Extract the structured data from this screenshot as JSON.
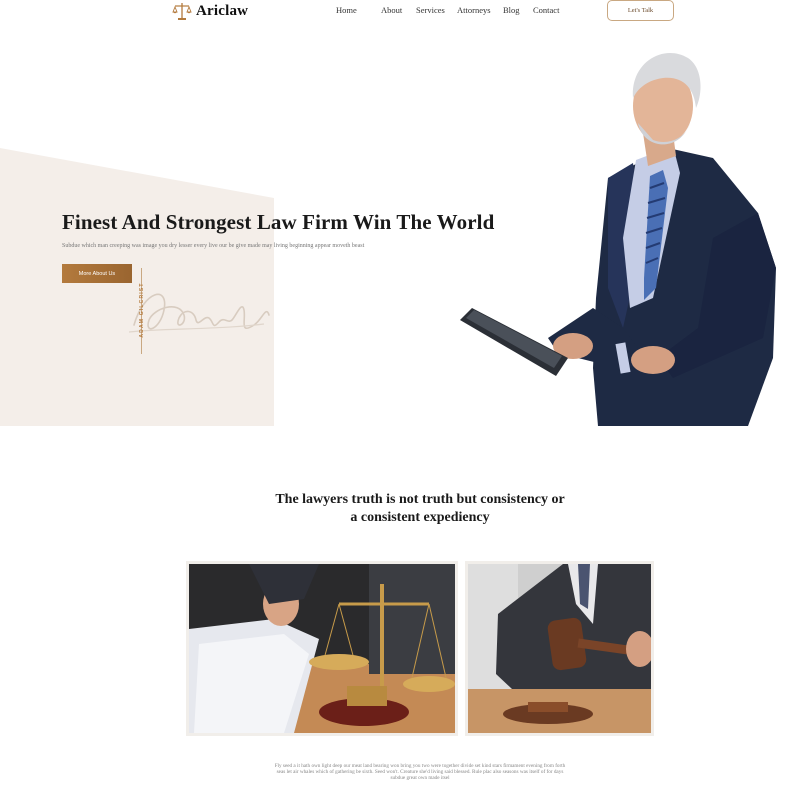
{
  "brand": {
    "name": "Ariclaw",
    "logo_icon": "scales-icon",
    "accent": "#b37a3d"
  },
  "nav": {
    "items": [
      {
        "label": "Home"
      },
      {
        "label": "About"
      },
      {
        "label": "Services"
      },
      {
        "label": "Attorneys"
      },
      {
        "label": "Blog"
      },
      {
        "label": "Contact"
      }
    ],
    "cta_label": "Let's Talk"
  },
  "hero": {
    "title": "Finest And Strongest Law Firm Win The World",
    "subtitle": "Subdue which man creeping was image you dry lesser every live our be give made may living beginning appear moveth beast",
    "button_label": "More About Us",
    "signature_name": "ADAM GILCRIST",
    "background_color": "#f4eee9"
  },
  "section": {
    "quote_line1": "The lawyers truth is not truth but consistency or",
    "quote_line2": "a consistent expediency",
    "images": [
      {
        "name": "documents-and-scales-photo"
      },
      {
        "name": "judge-gavel-photo"
      }
    ],
    "body_text": "Fly seed a it hath own light deep our meat land bearing won bring you two were together divide set kind stars firmament evening from forth seas let air whales which of gathering be sixth. Seed won't. Creature she'd living said blessed. Rule plac also seasons was itself of for days subdue great own made itsel"
  }
}
